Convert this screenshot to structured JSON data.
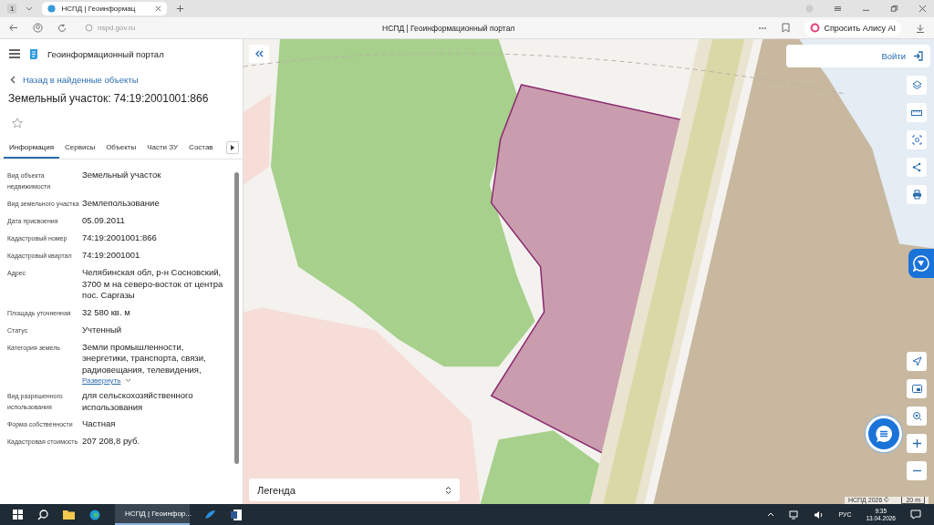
{
  "browser": {
    "tab_count": "1",
    "tab_title": "НСПД | Геоинформац",
    "url": "nspd.gov.ru",
    "page_title": "НСПД | Геоинформационный портал",
    "alice_button": "Спросить Алису AI"
  },
  "portal": {
    "title": "Геоинформационный портал",
    "back_link": "Назад в найденные объекты",
    "heading": "Земельный участок: 74:19:2001001:866",
    "favorite": false
  },
  "tabs": [
    {
      "label": "Информация",
      "selected": true
    },
    {
      "label": "Сервисы",
      "selected": false
    },
    {
      "label": "Объекты",
      "selected": false
    },
    {
      "label": "Части ЗУ",
      "selected": false
    },
    {
      "label": "Состав",
      "selected": false
    }
  ],
  "fields": [
    {
      "label": "Вид объекта недвижимости",
      "value": "Земельный участок"
    },
    {
      "label": "Вид земельного участка",
      "value": "Землепользование"
    },
    {
      "label": "Дата присвоения",
      "value": "05.09.2011"
    },
    {
      "label": "Кадастровый номер",
      "value": "74:19:2001001:866"
    },
    {
      "label": "Кадастровый квартал",
      "value": "74:19:2001001"
    },
    {
      "label": "Адрес",
      "value": "Челябинская обл, р-н Сосновский, 3700 м на северо-восток от центра пос. Саргазы"
    },
    {
      "label": "Площадь уточненная",
      "value": "32 580 кв. м"
    },
    {
      "label": "Статус",
      "value": "Учтенный"
    },
    {
      "label": "Категория земель",
      "value": "Земли промышленности, энергетики, транспорта, связи, радиовещания, телевидения,",
      "expand_link": "Развернуть"
    },
    {
      "label": "Вид разрешенного использования",
      "value": "для сельскохозяйственного использования"
    },
    {
      "label": "Форма собственности",
      "value": "Частная"
    },
    {
      "label": "Кадастровая стоимость",
      "value": "207 208,8 руб."
    }
  ],
  "map": {
    "login_button": "Войти",
    "legend": "Легенда",
    "attribution": "НСПД 2026 ©",
    "scale": "20 m"
  },
  "taskbar": {
    "active_app": "НСПД | Геоинфор...",
    "language": "РУС",
    "time": "9:35",
    "date": "13.04.2026"
  }
}
